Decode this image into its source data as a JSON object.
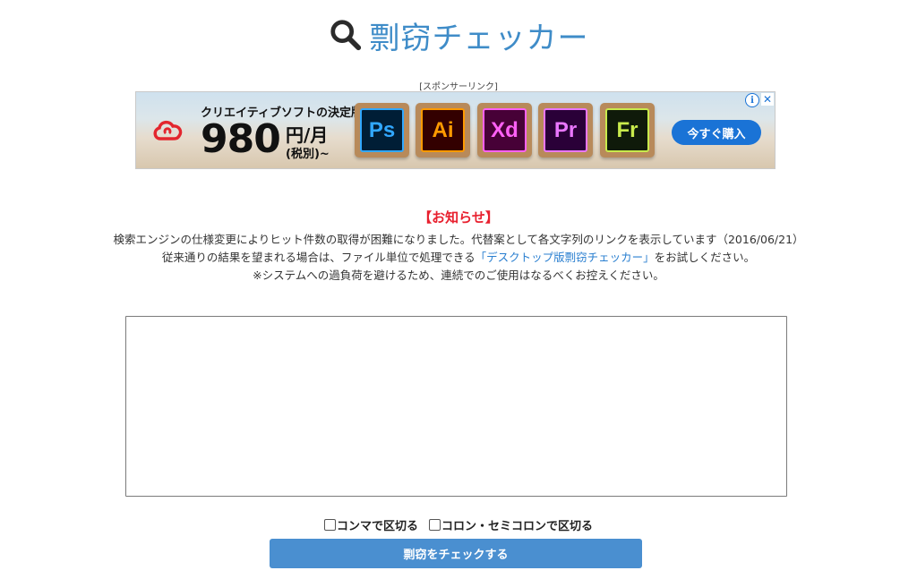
{
  "header": {
    "title": "剽窃チェッカー"
  },
  "ad": {
    "caption": "[スポンサーリンク]",
    "tagline": "クリエイティブソフトの決定版",
    "price": "980",
    "unit": "円/月",
    "tax": "(税別)~",
    "apps": [
      {
        "label": "Ps",
        "bg": "#001e36",
        "fg": "#31a8ff"
      },
      {
        "label": "Ai",
        "bg": "#330000",
        "fg": "#ff9a00"
      },
      {
        "label": "Xd",
        "bg": "#470137",
        "fg": "#ff61f6"
      },
      {
        "label": "Pr",
        "bg": "#2a0038",
        "fg": "#ea77ff"
      },
      {
        "label": "Fr",
        "bg": "#0f1a0a",
        "fg": "#c8ea4c"
      }
    ],
    "buy_label": "今すぐ購入",
    "info_label": "i",
    "close_label": "✕"
  },
  "notice": {
    "title": "【お知らせ】",
    "line1": "検索エンジンの仕様変更によりヒット件数の取得が困難になりました。代替案として各文字列のリンクを表示しています（2016/06/21）",
    "line2_before": "従来通りの結果を望まれる場合は、ファイル単位で処理できる",
    "line2_link": "「デスクトップ版剽窃チェッカー」",
    "line2_after": "をお試しください。",
    "line3": "※システムへの過負荷を避けるため、連続でのご使用はなるべくお控えください。"
  },
  "form": {
    "textarea_value": "",
    "option_comma": "コンマで区切る",
    "option_colon": "コロン・セミコロンで区切る",
    "submit_label": "剽窃をチェックする"
  },
  "colors": {
    "title": "#3f8cc8",
    "notice": "#e8202e",
    "link": "#2a7fd0",
    "button": "#4a8fd0"
  }
}
